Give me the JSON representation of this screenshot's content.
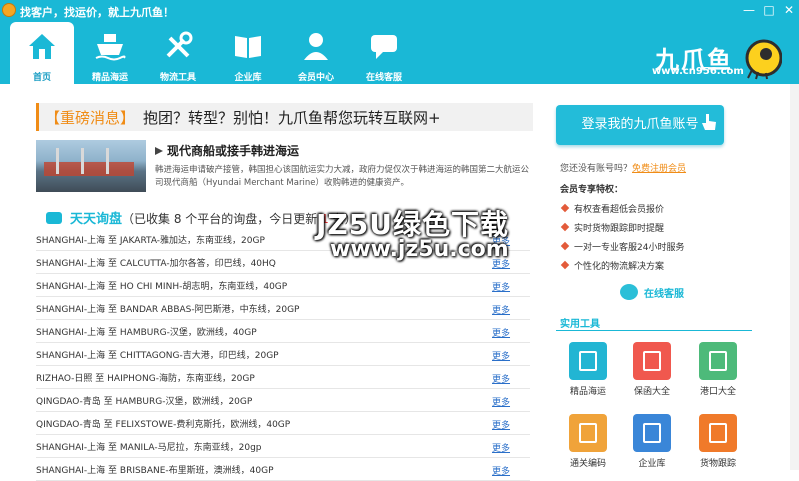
{
  "window": {
    "title": "找客户，找运价，就上九爪鱼！",
    "controls": [
      "minimize-icon",
      "maximize-icon",
      "close-icon"
    ]
  },
  "nav": {
    "items": [
      {
        "label": "首页",
        "icon": "home-icon",
        "active": true
      },
      {
        "label": "精品海运",
        "icon": "ship-icon"
      },
      {
        "label": "物流工具",
        "icon": "tools-icon"
      },
      {
        "label": "企业库",
        "icon": "book-icon"
      },
      {
        "label": "会员中心",
        "icon": "user-icon"
      },
      {
        "label": "在线客服",
        "icon": "chat-icon"
      }
    ],
    "brand": "九爪鱼",
    "brand_url": "www.cn956.com"
  },
  "headline": {
    "tag": "【重磅消息】",
    "text": "抱团？转型？别怕！九爪鱼帮您玩转互联网+"
  },
  "news": {
    "title": "现代商船或接手韩进海运",
    "body": "韩进海运申请破产接管，韩国担心该国航运实力大减，政府力促仅次于韩进海运的韩国第二大航运公司现代商船（Hyundai Merchant Marine）收购韩进的健康资产。"
  },
  "inquiry": {
    "title": "天天询盘",
    "summary_prefix": "（已收集 8 个平台的询盘，今日更新 ",
    "today_count": "1",
    "summary_suffix": " 条）",
    "more_label": "更多",
    "rows": [
      "SHANGHAI-上海 至 JAKARTA-雅加达，东南亚线，20GP",
      "SHANGHAI-上海 至 CALCUTTA-加尔各答，印巴线，40HQ",
      "SHANGHAI-上海 至 HO CHI MINH-胡志明，东南亚线，40GP",
      "SHANGHAI-上海 至 BANDAR ABBAS-阿巴斯港，中东线，20GP",
      "SHANGHAI-上海 至 HAMBURG-汉堡，欧洲线，40GP",
      "SHANGHAI-上海 至 CHITTAGONG-吉大港，印巴线，20GP",
      "RIZHAO-日照 至 HAIPHONG-海防，东南亚线，20GP",
      "QINGDAO-青岛 至 HAMBURG-汉堡，欧洲线，20GP",
      "QINGDAO-青岛 至 FELIXSTOWE-费利克斯托，欧洲线，40GP",
      "SHANGHAI-上海 至 MANILA-马尼拉，东南亚线，20gp",
      "SHANGHAI-上海 至 BRISBANE-布里斯班，澳洲线，40GP"
    ]
  },
  "sidebar": {
    "login_label": "登录我的九爪鱼账号",
    "no_account": "您还没有账号吗？",
    "register_link": "免费注册会员",
    "perks_title": "会员专享特权：",
    "perks": [
      "有权查看超低会员报价",
      "实时货物跟踪即时提醒",
      "一对一专业客服24小时服务",
      "个性化的物流解决方案"
    ],
    "service_label": "在线客服",
    "tools_title": "实用工具",
    "tools": [
      {
        "label": "精品海运",
        "color": "#22b5d3",
        "icon": "ship-icon"
      },
      {
        "label": "保函大全",
        "color": "#f0584e",
        "icon": "document-icon"
      },
      {
        "label": "港口大全",
        "color": "#4dba7a",
        "icon": "container-icon"
      },
      {
        "label": "通关编码",
        "color": "#f0a33a",
        "icon": "barcode-icon"
      },
      {
        "label": "企业库",
        "color": "#3a86d8",
        "icon": "book-icon"
      },
      {
        "label": "货物跟踪",
        "color": "#f07a2a",
        "icon": "location-icon"
      }
    ]
  },
  "watermark": {
    "line1": "JZ5U绿色下载",
    "line2": "www.jz5u.com"
  },
  "colors": {
    "primary": "#1ab8d6",
    "accent": "#f08c16",
    "link": "#2a6fc9"
  }
}
